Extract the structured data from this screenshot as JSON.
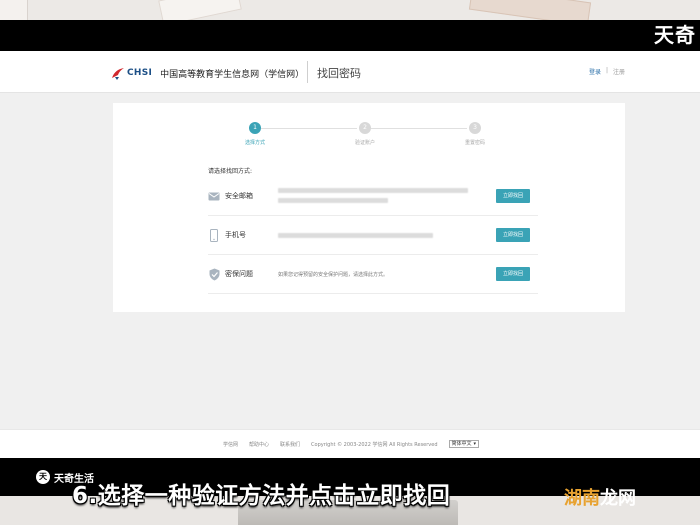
{
  "overlay": {
    "top_watermark": "天奇",
    "brand_badge_icon": "天",
    "brand_badge_text": "天奇生活",
    "caption": "6.选择一种验证方法并点击立即找回",
    "corner_watermark_part1": "湖南",
    "corner_watermark_part2": "龙网"
  },
  "header": {
    "logo_text": "CHSI",
    "site_name": "中国高等教育学生信息网（学信网）",
    "page_title": "找回密码",
    "login_link": "登录",
    "separator": "|",
    "register_link": "注册"
  },
  "steps": [
    {
      "number": "1",
      "label": "选择方式",
      "active": true
    },
    {
      "number": "2",
      "label": "验证账户",
      "active": false
    },
    {
      "number": "3",
      "label": "重置密码",
      "active": false
    }
  ],
  "choose_prompt": "请选择找回方式:",
  "methods": [
    {
      "icon": "mail-icon",
      "name": "安全邮箱",
      "description": "",
      "button": "立即找回"
    },
    {
      "icon": "phone-icon",
      "name": "手机号",
      "description": "",
      "button": "立即找回"
    },
    {
      "icon": "shield-check-icon",
      "name": "密保问题",
      "description": "如果您记得预留的安全保护问题，请选择此方式。",
      "button": "立即找回"
    }
  ],
  "footer": {
    "links": [
      "学信网",
      "帮助中心",
      "联系我们"
    ],
    "copyright": "Copyright © 2003-2022 学信网 All Rights Reserved",
    "language_selected": "简体中文"
  },
  "colors": {
    "accent": "#3aa3b6",
    "link": "#2a6fa8",
    "bar": "#000000",
    "watermark_orange": "#e8a230"
  }
}
